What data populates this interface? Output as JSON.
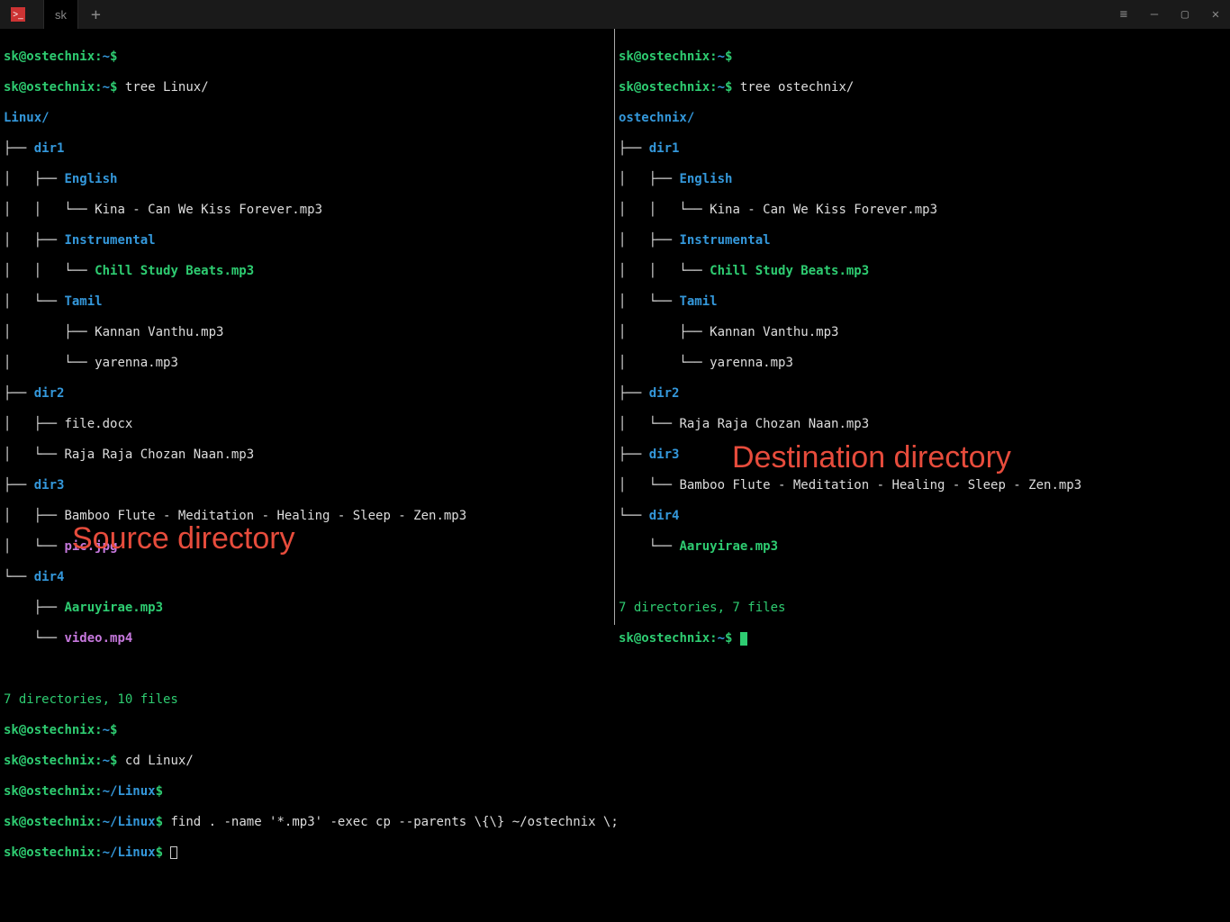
{
  "titlebar": {
    "tab_label": "sk",
    "plus_label": "+"
  },
  "window_controls": {
    "menu": "≡",
    "minimize": "—",
    "maximize": "▢",
    "close": "✕"
  },
  "left": {
    "user": "sk",
    "host": "ostechnix",
    "home": "~",
    "root_cmd": "tree Linux/",
    "root_dir": "Linux/",
    "dir1": "dir1",
    "english": "English",
    "english_file": "Kina - Can We Kiss Forever.mp3",
    "instrumental": "Instrumental",
    "instrumental_file": "Chill Study Beats.mp3",
    "tamil": "Tamil",
    "tamil_file1": "Kannan Vanthu.mp3",
    "tamil_file2": "yarenna.mp3",
    "dir2": "dir2",
    "dir2_file1": "file.docx",
    "dir2_file2": "Raja Raja Chozan Naan.mp3",
    "dir3": "dir3",
    "dir3_file1": "Bamboo Flute - Meditation - Healing - Sleep - Zen.mp3",
    "dir3_file2": "pic.jpg",
    "dir4": "dir4",
    "dir4_file1": "Aaruyirae.mp3",
    "dir4_file2": "video.mp4",
    "summary": "7 directories, 10 files",
    "cd_cmd": "cd Linux/",
    "linux_path": "~/Linux",
    "find_cmd": "find . -name '*.mp3' -exec cp --parents \\{\\} ~/ostechnix \\;",
    "label": "Source directory"
  },
  "right": {
    "user": "sk",
    "host": "ostechnix",
    "home": "~",
    "root_cmd": "tree ostechnix/",
    "root_dir": "ostechnix/",
    "dir1": "dir1",
    "english": "English",
    "english_file": "Kina - Can We Kiss Forever.mp3",
    "instrumental": "Instrumental",
    "instrumental_file": "Chill Study Beats.mp3",
    "tamil": "Tamil",
    "tamil_file1": "Kannan Vanthu.mp3",
    "tamil_file2": "yarenna.mp3",
    "dir2": "dir2",
    "dir2_file1": "Raja Raja Chozan Naan.mp3",
    "dir3": "dir3",
    "dir3_file1": "Bamboo Flute - Meditation - Healing - Sleep - Zen.mp3",
    "dir4": "dir4",
    "dir4_file1": "Aaruyirae.mp3",
    "summary": "7 directories, 7 files",
    "label": "Destination directory"
  }
}
